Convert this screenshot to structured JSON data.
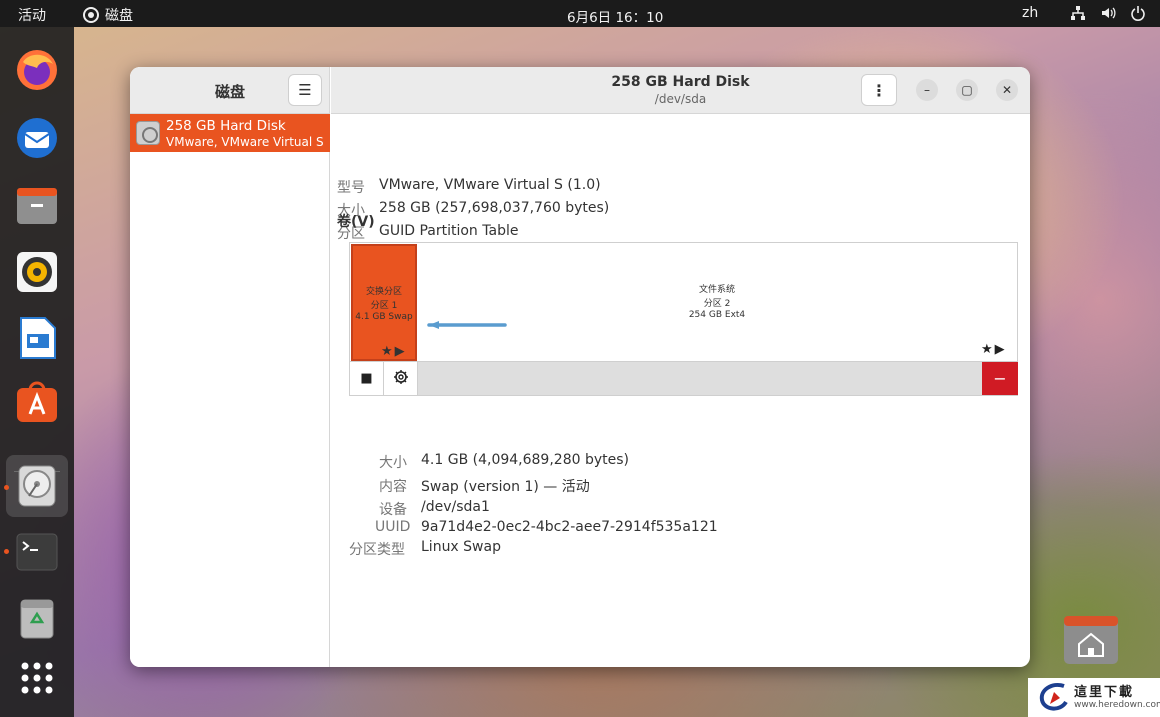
{
  "topbar": {
    "activities": "活动",
    "app_name": "磁盘",
    "clock": "6月6日  16：10",
    "lang": "zh"
  },
  "dock": {
    "apps": [
      "firefox",
      "thunderbird",
      "files",
      "rhythmbox",
      "libreoffice-impress",
      "app-center",
      "disks",
      "terminal",
      "trash",
      "show-apps"
    ]
  },
  "sidebar": {
    "title": "磁盘",
    "disks": [
      {
        "name": "258 GB Hard Disk",
        "model": "VMware, VMware Virtual S"
      }
    ]
  },
  "header": {
    "title": "258 GB Hard Disk",
    "subtitle": "/dev/sda"
  },
  "drive_info": {
    "model_label": "型号",
    "model_value": "VMware, VMware Virtual S (1.0)",
    "size_label": "大小",
    "size_value": "258 GB (257,698,037,760 bytes)",
    "partitioning_label": "分区",
    "partitioning_value": "GUID Partition Table"
  },
  "volumes": {
    "title": "卷(V)",
    "swap": {
      "line1": "交换分区",
      "line2": "分区 1",
      "line3": "4.1 GB Swap"
    },
    "filesystem": {
      "line1": "文件系统",
      "line2": "分区 2",
      "line3": "254 GB Ext4"
    }
  },
  "volume_details": {
    "size_label": "大小",
    "size_value": "4.1 GB (4,094,689,280 bytes)",
    "contents_label": "内容",
    "contents_value": "Swap (version 1) — 活动",
    "device_label": "设备",
    "device_value": "/dev/sda1",
    "uuid_label": "UUID",
    "uuid_value": "9a71d4e2-0ec2-4bc2-aee7-2914f535a121",
    "ptype_label": "分区类型",
    "ptype_value": "Linux Swap"
  },
  "watermark": {
    "title": "這里下載",
    "url": "www.heredown.com"
  },
  "colors": {
    "accent": "#e95420",
    "delete": "#d01b24",
    "topbar": "#1b1b1b"
  }
}
